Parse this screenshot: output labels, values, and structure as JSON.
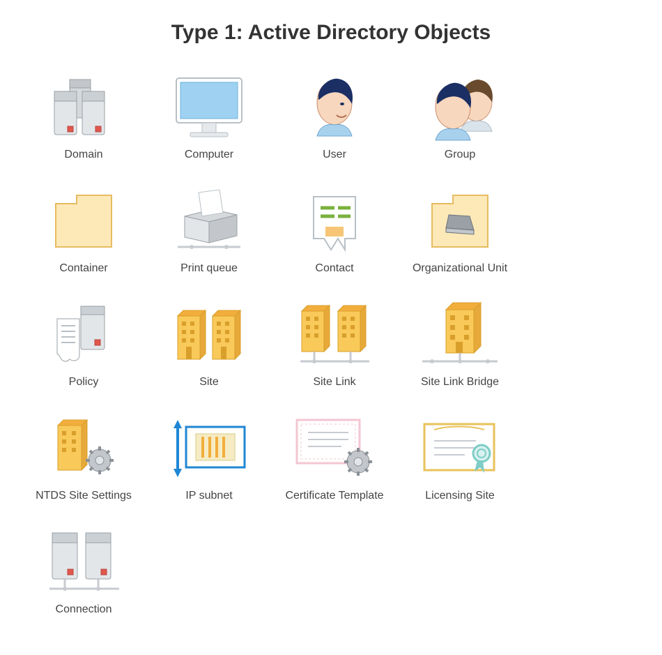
{
  "title": "Type 1: Active Directory Objects",
  "items": [
    {
      "id": "domain",
      "label": "Domain"
    },
    {
      "id": "computer",
      "label": "Computer"
    },
    {
      "id": "user",
      "label": "User"
    },
    {
      "id": "group",
      "label": "Group"
    },
    {
      "id": "container",
      "label": "Container"
    },
    {
      "id": "print-queue",
      "label": "Print queue"
    },
    {
      "id": "contact",
      "label": "Contact"
    },
    {
      "id": "organizational-unit",
      "label": "Organizational Unit"
    },
    {
      "id": "policy",
      "label": "Policy"
    },
    {
      "id": "site",
      "label": "Site"
    },
    {
      "id": "site-link",
      "label": "Site Link"
    },
    {
      "id": "site-link-bridge",
      "label": "Site Link Bridge"
    },
    {
      "id": "ntds-site-settings",
      "label": "NTDS Site Settings"
    },
    {
      "id": "ip-subnet",
      "label": "IP subnet"
    },
    {
      "id": "certificate-template",
      "label": "Certificate Template"
    },
    {
      "id": "licensing-site",
      "label": "Licensing Site"
    },
    {
      "id": "connection",
      "label": "Connection"
    }
  ],
  "colors": {
    "title": "#333333",
    "label": "#444444",
    "folderFill": "#fde9b8",
    "folderStroke": "#e6bb5f",
    "buildingFill": "#f9c95a",
    "buildingStroke": "#d99f2b",
    "serverFill": "#d6d9dc",
    "serverStroke": "#9aa0a6",
    "serverRed": "#e1574c",
    "screenBlue": "#9ed1f2",
    "paperFill": "#ffffff",
    "paperStroke": "#9aa0a6",
    "certPink": "#f3c6d2",
    "ipBlue": "#1f87d6",
    "ipOrange": "#f2ae3c"
  }
}
